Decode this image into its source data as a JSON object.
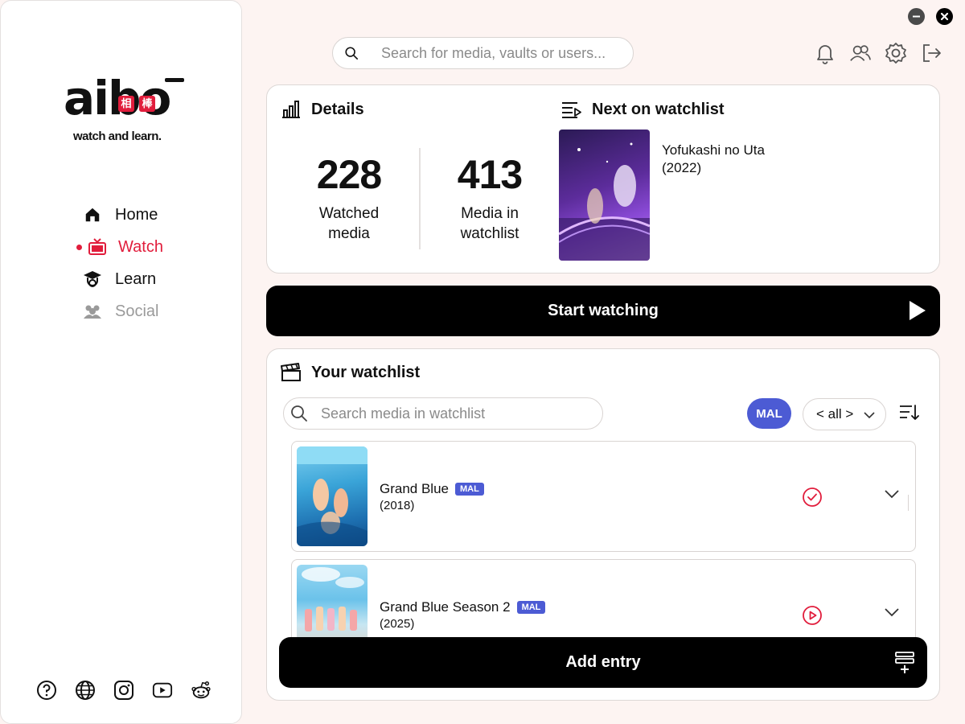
{
  "app": {
    "logo_text": "aibo",
    "logo_kanji": [
      "相",
      "棒"
    ],
    "tagline": "watch and learn."
  },
  "window_controls": {
    "minimize": "minimize-icon",
    "close": "close-icon"
  },
  "nav": {
    "items": [
      {
        "label": "Home",
        "icon": "home-icon",
        "state": "normal"
      },
      {
        "label": "Watch",
        "icon": "tv-icon",
        "state": "active"
      },
      {
        "label": "Learn",
        "icon": "graduation-cap-icon",
        "state": "normal"
      },
      {
        "label": "Social",
        "icon": "users-icon",
        "state": "disabled"
      }
    ]
  },
  "social_links": [
    "help-icon",
    "globe-icon",
    "instagram-icon",
    "youtube-icon",
    "reddit-icon"
  ],
  "header": {
    "search_placeholder": "Search for media, vaults or users...",
    "icons": [
      "bell-icon",
      "friends-icon",
      "gear-icon",
      "logout-icon"
    ]
  },
  "details": {
    "title": "Details",
    "stats": [
      {
        "value": "228",
        "label": "Watched media"
      },
      {
        "value": "413",
        "label": "Media in watchlist"
      }
    ]
  },
  "next_on_watchlist": {
    "title": "Next on watchlist",
    "media_title": "Yofukashi no Uta",
    "year": "(2022)"
  },
  "start_button": {
    "label": "Start watching"
  },
  "watchlist": {
    "title": "Your watchlist",
    "search_placeholder": "Search media in watchlist",
    "source_filter": "MAL",
    "status_filter": "< all >",
    "entries": [
      {
        "title": "Grand Blue",
        "source": "MAL",
        "year": "(2018)",
        "status_icon": "check-circle-icon"
      },
      {
        "title": "Grand Blue Season 2",
        "source": "MAL",
        "year": "(2025)",
        "status_icon": "play-circle-icon"
      }
    ]
  },
  "add_button": {
    "label": "Add entry"
  },
  "colors": {
    "accent": "#e11d3c",
    "mal": "#4c5bd4",
    "background": "#fdf4f2"
  }
}
